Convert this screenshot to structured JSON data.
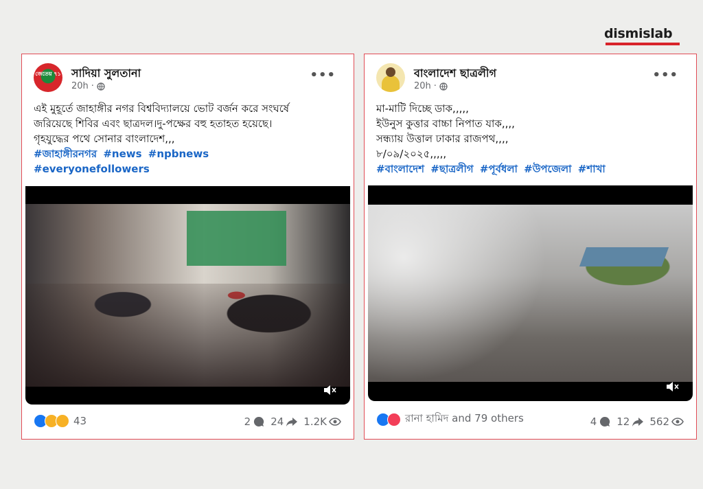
{
  "brand": {
    "name": "dismislab",
    "accent": "#d8232a"
  },
  "posts": [
    {
      "author": "সাদিয়া সুলতানা",
      "avatar_text": "জেতেয় ৭১",
      "time": "20h",
      "lines": [
        "এই মুহূর্তে জাহাঙ্গীর নগর বিশ্ববিদ্যালয়ে ভোট বর্জন করে সংঘর্ষে",
        "জরিয়েছে শিবির এবং ছাত্রদল।দু-পক্ষের বহু হতাহত হয়েছে।",
        "গৃহযুদ্ধের পথে সোনার বাংলাদেশ,,,"
      ],
      "hashtags_1": [
        "#জাহাঙ্গীরনগর",
        "#news",
        "#npbnews"
      ],
      "hashtags_2": [
        "#everyonefollowers"
      ],
      "reactions": [
        "like",
        "sad",
        "haha"
      ],
      "reaction_count": "43",
      "comments": "2",
      "shares": "24",
      "views": "1.2K"
    },
    {
      "author": "বাংলাদেশ ছাত্রলীগ",
      "time": "20h",
      "lines": [
        "মা-মাটি দিচ্ছে ডাক,,,,,",
        "ইউনুস কুত্তার বাচ্চা নিপাত যাক,,,,",
        "সন্ধ্যায় উত্তাল ঢাকার রাজপথ,,,,",
        "৮/০৯/২০২৫,,,,,"
      ],
      "hashtags_1": [
        "#বাংলাদেশ",
        "#ছাত্রলীগ",
        "#পূর্বধলা",
        "#উপজেলা",
        "#শাখা"
      ],
      "reactions": [
        "like",
        "love"
      ],
      "reaction_count": "রানা হামিদ and 79 others",
      "comments": "4",
      "shares": "12",
      "views": "562"
    }
  ]
}
